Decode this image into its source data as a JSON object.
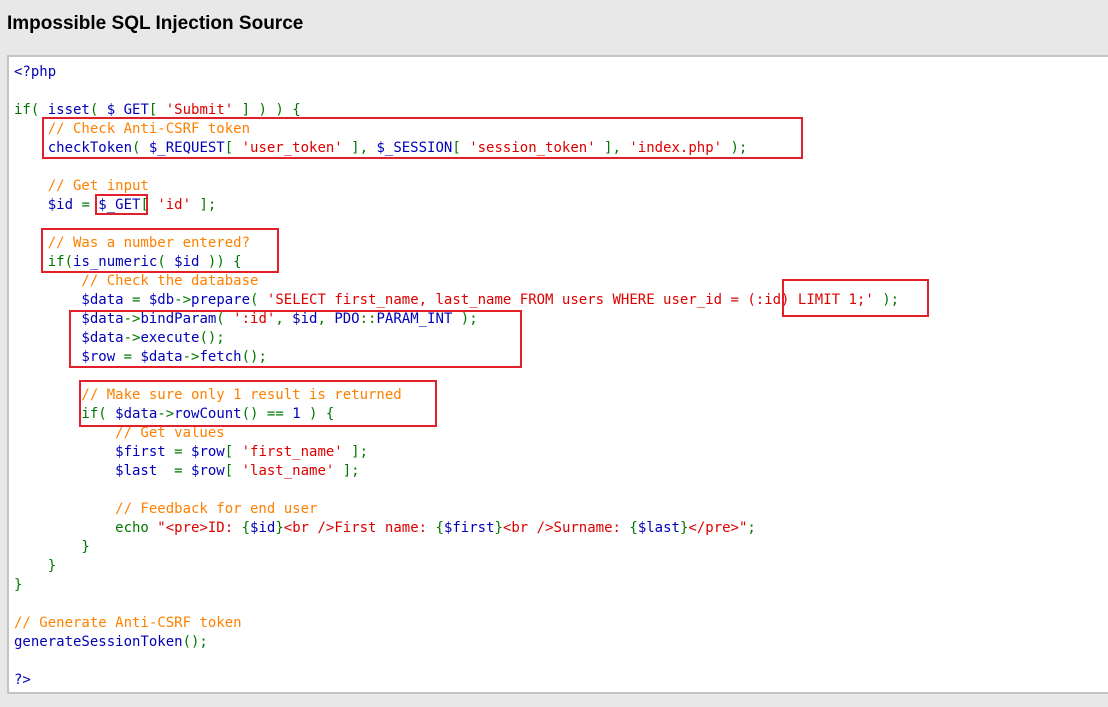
{
  "page": {
    "title": "Impossible SQL Injection Source"
  },
  "colors": {
    "default": "#0000bb",
    "keyword": "#007700",
    "string": "#dd0000",
    "comment": "#ff8000",
    "html": "#000000",
    "highlight_box": "#e3202a"
  },
  "code": {
    "lines": [
      [
        {
          "c": "plain",
          "t": "<?php"
        }
      ],
      [],
      [
        {
          "c": "kw",
          "t": "if( "
        },
        {
          "c": "plain",
          "t": "isset"
        },
        {
          "c": "kw",
          "t": "( "
        },
        {
          "c": "plain",
          "t": "$_GET"
        },
        {
          "c": "kw",
          "t": "[ "
        },
        {
          "c": "str",
          "t": "'Submit'"
        },
        {
          "c": "kw",
          "t": " ] ) ) {"
        }
      ],
      [
        {
          "c": "cmt",
          "t": "    // Check Anti-CSRF token"
        }
      ],
      [
        {
          "c": "plain",
          "t": "    checkToken"
        },
        {
          "c": "kw",
          "t": "( "
        },
        {
          "c": "plain",
          "t": "$_REQUEST"
        },
        {
          "c": "kw",
          "t": "[ "
        },
        {
          "c": "str",
          "t": "'user_token'"
        },
        {
          "c": "kw",
          "t": " ], "
        },
        {
          "c": "plain",
          "t": "$_SESSION"
        },
        {
          "c": "kw",
          "t": "[ "
        },
        {
          "c": "str",
          "t": "'session_token'"
        },
        {
          "c": "kw",
          "t": " ], "
        },
        {
          "c": "str",
          "t": "'index.php'"
        },
        {
          "c": "kw",
          "t": " );"
        }
      ],
      [],
      [
        {
          "c": "cmt",
          "t": "    // Get input"
        }
      ],
      [
        {
          "c": "plain",
          "t": "    $id "
        },
        {
          "c": "kw",
          "t": "= "
        },
        {
          "c": "plain",
          "t": "$_GET"
        },
        {
          "c": "kw",
          "t": "[ "
        },
        {
          "c": "str",
          "t": "'id'"
        },
        {
          "c": "kw",
          "t": " ];"
        }
      ],
      [],
      [
        {
          "c": "cmt",
          "t": "    // Was a number entered?"
        }
      ],
      [
        {
          "c": "kw",
          "t": "    if("
        },
        {
          "c": "plain",
          "t": "is_numeric"
        },
        {
          "c": "kw",
          "t": "( "
        },
        {
          "c": "plain",
          "t": "$id "
        },
        {
          "c": "kw",
          "t": ")) {"
        }
      ],
      [
        {
          "c": "cmt",
          "t": "        // Check the database"
        }
      ],
      [
        {
          "c": "plain",
          "t": "        $data "
        },
        {
          "c": "kw",
          "t": "= "
        },
        {
          "c": "plain",
          "t": "$db"
        },
        {
          "c": "kw",
          "t": "->"
        },
        {
          "c": "plain",
          "t": "prepare"
        },
        {
          "c": "kw",
          "t": "( "
        },
        {
          "c": "str",
          "t": "'SELECT first_name, last_name FROM users WHERE user_id = (:id) LIMIT 1;'"
        },
        {
          "c": "kw",
          "t": " );"
        }
      ],
      [
        {
          "c": "plain",
          "t": "        $data"
        },
        {
          "c": "kw",
          "t": "->"
        },
        {
          "c": "plain",
          "t": "bindParam"
        },
        {
          "c": "kw",
          "t": "( "
        },
        {
          "c": "str",
          "t": "':id'"
        },
        {
          "c": "kw",
          "t": ", "
        },
        {
          "c": "plain",
          "t": "$id"
        },
        {
          "c": "kw",
          "t": ", "
        },
        {
          "c": "plain",
          "t": "PDO"
        },
        {
          "c": "kw",
          "t": "::"
        },
        {
          "c": "plain",
          "t": "PARAM_INT "
        },
        {
          "c": "kw",
          "t": ");"
        }
      ],
      [
        {
          "c": "plain",
          "t": "        $data"
        },
        {
          "c": "kw",
          "t": "->"
        },
        {
          "c": "plain",
          "t": "execute"
        },
        {
          "c": "kw",
          "t": "();"
        }
      ],
      [
        {
          "c": "plain",
          "t": "        $row "
        },
        {
          "c": "kw",
          "t": "= "
        },
        {
          "c": "plain",
          "t": "$data"
        },
        {
          "c": "kw",
          "t": "->"
        },
        {
          "c": "plain",
          "t": "fetch"
        },
        {
          "c": "kw",
          "t": "();"
        }
      ],
      [],
      [
        {
          "c": "cmt",
          "t": "        // Make sure only 1 result is returned"
        }
      ],
      [
        {
          "c": "kw",
          "t": "        if( "
        },
        {
          "c": "plain",
          "t": "$data"
        },
        {
          "c": "kw",
          "t": "->"
        },
        {
          "c": "plain",
          "t": "rowCount"
        },
        {
          "c": "kw",
          "t": "() == "
        },
        {
          "c": "plain",
          "t": "1 "
        },
        {
          "c": "kw",
          "t": ") {"
        }
      ],
      [
        {
          "c": "cmt",
          "t": "            // Get values"
        }
      ],
      [
        {
          "c": "plain",
          "t": "            $first "
        },
        {
          "c": "kw",
          "t": "= "
        },
        {
          "c": "plain",
          "t": "$row"
        },
        {
          "c": "kw",
          "t": "[ "
        },
        {
          "c": "str",
          "t": "'first_name'"
        },
        {
          "c": "kw",
          "t": " ];"
        }
      ],
      [
        {
          "c": "plain",
          "t": "            $last  "
        },
        {
          "c": "kw",
          "t": "= "
        },
        {
          "c": "plain",
          "t": "$row"
        },
        {
          "c": "kw",
          "t": "[ "
        },
        {
          "c": "str",
          "t": "'last_name'"
        },
        {
          "c": "kw",
          "t": " ];"
        }
      ],
      [],
      [
        {
          "c": "cmt",
          "t": "            // Feedback for end user"
        }
      ],
      [
        {
          "c": "kw",
          "t": "            echo "
        },
        {
          "c": "str",
          "t": "\"<pre>ID: "
        },
        {
          "c": "kw",
          "t": "{"
        },
        {
          "c": "plain",
          "t": "$id"
        },
        {
          "c": "kw",
          "t": "}"
        },
        {
          "c": "str",
          "t": "<br />First name: "
        },
        {
          "c": "kw",
          "t": "{"
        },
        {
          "c": "plain",
          "t": "$first"
        },
        {
          "c": "kw",
          "t": "}"
        },
        {
          "c": "str",
          "t": "<br />Surname: "
        },
        {
          "c": "kw",
          "t": "{"
        },
        {
          "c": "plain",
          "t": "$last"
        },
        {
          "c": "kw",
          "t": "}"
        },
        {
          "c": "str",
          "t": "</pre>\""
        },
        {
          "c": "kw",
          "t": ";"
        }
      ],
      [
        {
          "c": "kw",
          "t": "        }"
        }
      ],
      [
        {
          "c": "kw",
          "t": "    }"
        }
      ],
      [
        {
          "c": "kw",
          "t": "}"
        }
      ],
      [],
      [
        {
          "c": "cmt",
          "t": "// Generate Anti-CSRF token"
        }
      ],
      [
        {
          "c": "plain",
          "t": "generateSessionToken"
        },
        {
          "c": "kw",
          "t": "();"
        }
      ],
      [],
      [
        {
          "c": "plain",
          "t": "?>"
        }
      ]
    ]
  }
}
